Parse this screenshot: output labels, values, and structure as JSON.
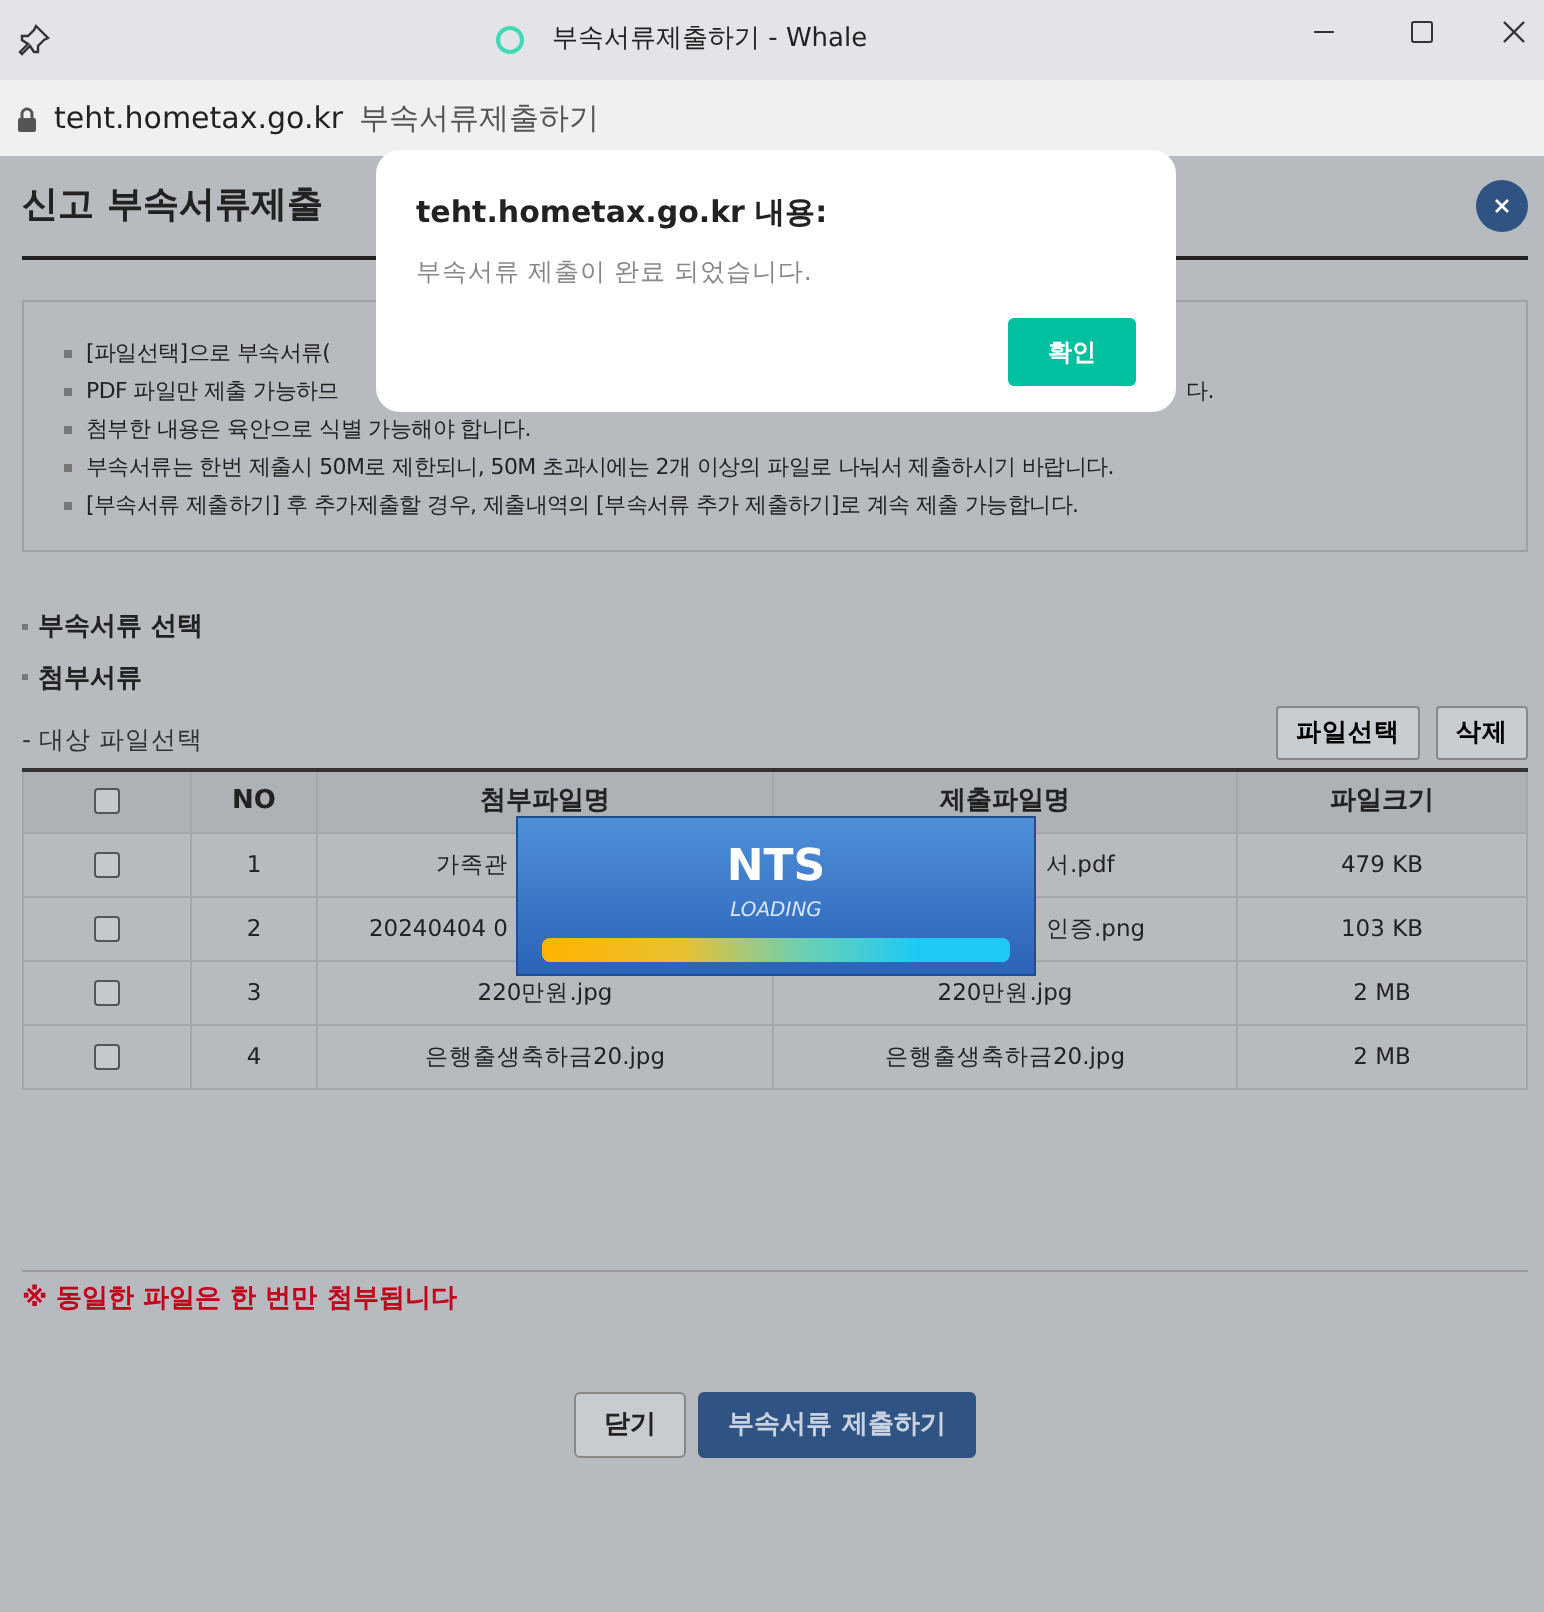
{
  "browser": {
    "title": "부속서류제출하기 - Whale",
    "url": "teht.hometax.go.kr",
    "page_title": "부속서류제출하기"
  },
  "page": {
    "heading": "신고 부속서류제출",
    "notices": [
      {
        "text": "[파일선택]으로 부속서류("
      },
      {
        "text": "PDF 파일만 제출 가능하므",
        "tail": "다."
      },
      {
        "text": "첨부한 내용은 육안으로 식별 가능해야 합니다."
      },
      {
        "text": "부속서류는 한번 제출시 50M로 제한되니, 50M 초과시에는 2개 이상의 파일로 나눠서 제출하시기 바랍니다."
      },
      {
        "text": "[부속서류 제출하기] 후 추가제출할 경우, 제출내역의 [부속서류 추가 제출하기]로 계속 제출 가능합니다."
      }
    ],
    "sections": [
      "부속서류 선택",
      "첨부서류"
    ],
    "file_label": "- 대상 파일선택",
    "file_buttons": [
      "파일선택",
      "삭제"
    ],
    "table": {
      "header_checked": false,
      "columns": [
        "NO",
        "첨부파일명",
        "제출파일명",
        "파일크기"
      ],
      "rows": [
        {
          "checked": false,
          "cells": [
            {
              "text": "1"
            },
            {
              "text": "가족관",
              "clipped_end": true
            },
            {
              "text": "서.pdf",
              "clipped_start": true
            },
            {
              "text": "479 KB"
            }
          ]
        },
        {
          "checked": false,
          "cells": [
            {
              "text": "2"
            },
            {
              "text": "20240404 0",
              "clipped_end": true
            },
            {
              "text": "인증.png",
              "clipped_start": true
            },
            {
              "text": "103 KB"
            }
          ]
        },
        {
          "checked": false,
          "cells": [
            {
              "text": "3"
            },
            {
              "text": "220만원.jpg"
            },
            {
              "text": "220만원.jpg"
            },
            {
              "text": "2 MB"
            }
          ]
        },
        {
          "checked": false,
          "cells": [
            {
              "text": "4"
            },
            {
              "text": "은행출생축하금20.jpg"
            },
            {
              "text": "은행출생축하금20.jpg"
            },
            {
              "text": "2 MB"
            }
          ]
        }
      ]
    },
    "warning": "※ 동일한 파일은 한 번만 첨부됩니다",
    "footer_buttons": [
      {
        "label": "닫기",
        "kind": "secondary"
      },
      {
        "label": "부속서류 제출하기",
        "kind": "primary"
      }
    ]
  },
  "dialog": {
    "title": "teht.hometax.go.kr 내용:",
    "message": "부속서류 제출이 완료 되었습니다.",
    "button": "확인"
  },
  "loading": {
    "title": "NTS",
    "subtitle": "LOADING",
    "level": 1
  }
}
